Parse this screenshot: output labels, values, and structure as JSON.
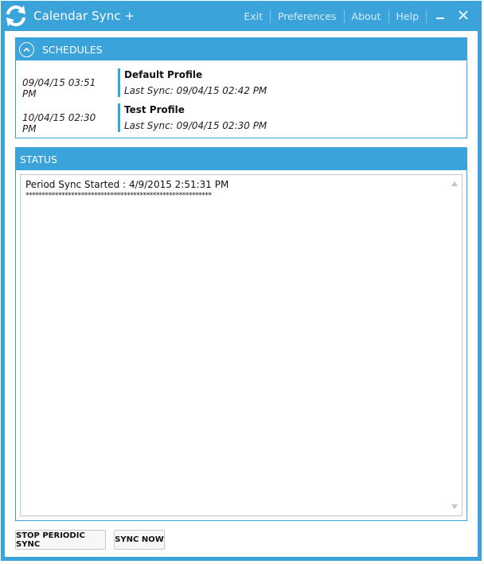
{
  "window": {
    "title": "Calendar Sync +"
  },
  "menu": {
    "exit": "Exit",
    "preferences": "Preferences",
    "about": "About",
    "help": "Help"
  },
  "schedules": {
    "header": "SCHEDULES",
    "items": [
      {
        "time": "09/04/15 03:51 PM",
        "name": "Default Profile",
        "last_sync": "Last Sync: 09/04/15 02:42 PM"
      },
      {
        "time": "10/04/15 02:30 PM",
        "name": "Test Profile",
        "last_sync": "Last Sync: 09/04/15 02:30 PM"
      }
    ]
  },
  "status": {
    "header": "STATUS",
    "lines": [
      "Period Sync Started : 4/9/2015 2:51:31 PM",
      "*********************************************************"
    ]
  },
  "buttons": {
    "stop_periodic_sync": "STOP PERIODIC SYNC",
    "sync_now": "SYNC NOW"
  },
  "icons": {
    "logo": "sync-arrows-icon",
    "minimize": "minimize-icon",
    "close": "close-icon",
    "collapse": "chevron-up-icon"
  },
  "colors": {
    "accent": "#3aa3d9",
    "menu_text": "#d6ecf8"
  }
}
